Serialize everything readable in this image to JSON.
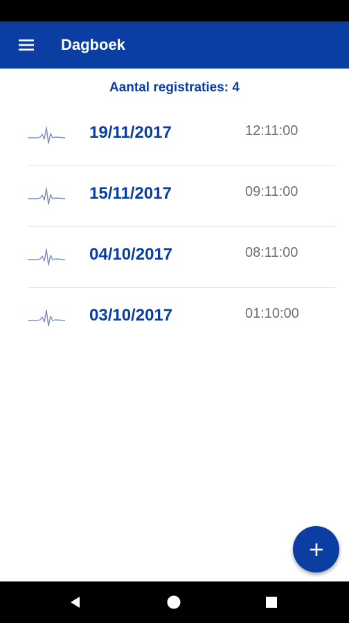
{
  "app_bar": {
    "title": "Dagboek",
    "menu_icon": "hamburger-menu-icon",
    "background_color": "#0a3ea3"
  },
  "summary": {
    "count_text": "Aantal registraties: 4"
  },
  "entries": [
    {
      "date": "19/11/2017",
      "time": "12:11:00",
      "icon": "heartbeat-pulse-icon"
    },
    {
      "date": "15/11/2017",
      "time": "09:11:00",
      "icon": "heartbeat-pulse-icon"
    },
    {
      "date": "04/10/2017",
      "time": "08:11:00",
      "icon": "heartbeat-pulse-icon"
    },
    {
      "date": "03/10/2017",
      "time": "01:10:00",
      "icon": "heartbeat-pulse-icon"
    }
  ],
  "fab": {
    "icon": "plus-icon"
  },
  "system_nav": {
    "back_icon": "back-triangle-icon",
    "home_icon": "home-circle-icon",
    "recents_icon": "recents-square-icon"
  },
  "colors": {
    "primary": "#0a3ea3",
    "time_text": "#707070",
    "divider": "#e3e3e3"
  }
}
